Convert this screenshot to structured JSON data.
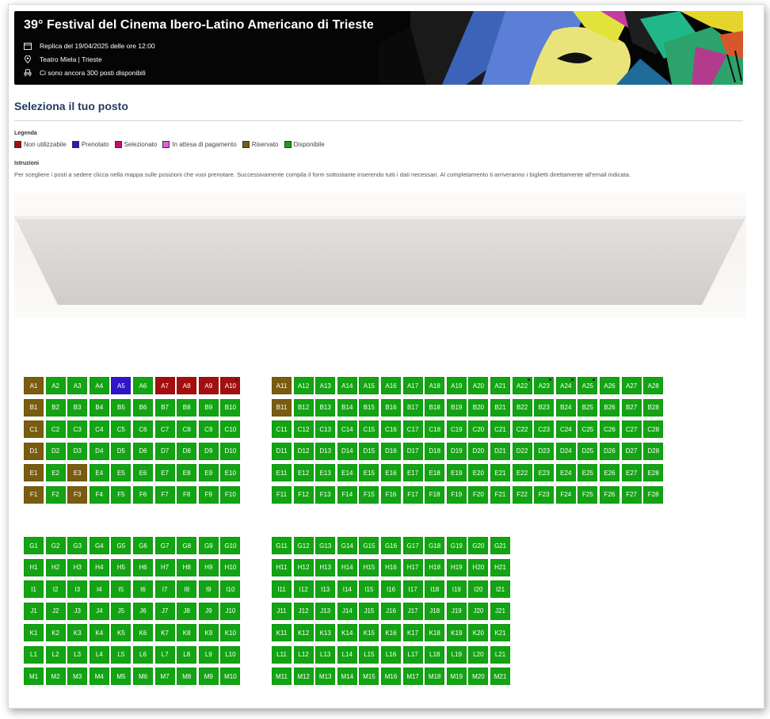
{
  "event": {
    "title": "39° Festival del Cinema Ibero-Latino Americano di Trieste",
    "date_line": "Replica del 19/04/2025 delle ore 12:00",
    "venue_line": "Teatro Miela | Trieste",
    "seats_line": "Ci sono ancora 300 posti disponibili"
  },
  "heading": "Seleziona il tuo posto",
  "legend": {
    "title": "Legenda",
    "items": [
      {
        "label": "Non utilizzabile",
        "color": "#a30f0f"
      },
      {
        "label": "Prenotato",
        "color": "#2f16c9"
      },
      {
        "label": "Selezionato",
        "color": "#c80e6b"
      },
      {
        "label": "In attesa di pagamento",
        "color": "#e15ee0"
      },
      {
        "label": "Riservato",
        "color": "#7a5c10"
      },
      {
        "label": "Disponibile",
        "color": "#13a413"
      }
    ]
  },
  "instructions": {
    "title": "Istruzioni",
    "text": "Per scegliere i posti a sedere clicca nella mappa sulle posizioni che vuoi prenotare. Successivamente compila il form sottostante inserendo tutti i dati necessari. Al completamento ti arriveranno i biglietti direttamente all'email indicata."
  },
  "status_colors": {
    "disponibile": "#13a413",
    "riservato": "#7a5c10",
    "prenotato": "#2f16c9",
    "non_utilizzabile": "#a30f0f"
  },
  "seat_blocks": [
    {
      "rows": [
        "A",
        "B",
        "C",
        "D",
        "E",
        "F"
      ],
      "from": 1,
      "to": 10
    },
    {
      "rows": [
        "A",
        "B",
        "C",
        "D",
        "E",
        "F"
      ],
      "from": 11,
      "to": 28
    },
    {
      "rows": [
        "G",
        "H",
        "I",
        "J",
        "K",
        "L",
        "M"
      ],
      "from": 1,
      "to": 10
    },
    {
      "rows": [
        "G",
        "H",
        "I",
        "J",
        "K",
        "L",
        "M"
      ],
      "from": 11,
      "to": 21
    }
  ],
  "seat_status": {
    "A1": "riservato",
    "B1": "riservato",
    "C1": "riservato",
    "D1": "riservato",
    "E1": "riservato",
    "F1": "riservato",
    "E3": "riservato",
    "F3": "riservato",
    "A11": "riservato",
    "B11": "riservato",
    "A5": "prenotato",
    "A7": "non_utilizzabile",
    "A8": "non_utilizzabile",
    "A9": "non_utilizzabile",
    "A10": "non_utilizzabile"
  },
  "seat_markers": [
    "A10",
    "A22",
    "A23",
    "A24",
    "A25"
  ]
}
